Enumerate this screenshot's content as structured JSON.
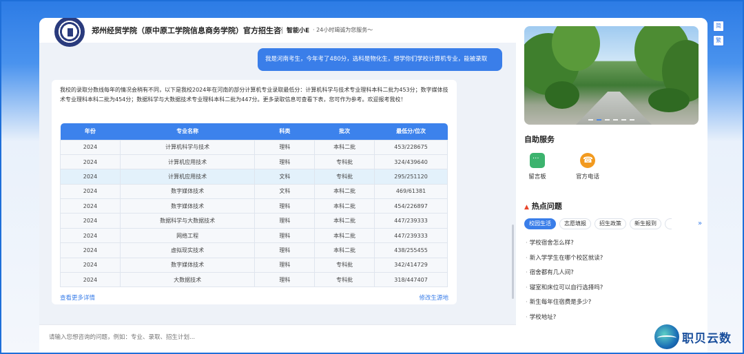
{
  "header": {
    "title": "郑州经贸学院（原中原工学院信息商务学院）官方招生咨询...",
    "agent": "智能小E",
    "tagline": "· 24小时竭诚为您服务～"
  },
  "chat": {
    "user_message": "我是河南考生，今年考了480分，选科是物化生，想学你们学校计算机专业，能被录取",
    "bot_intro": "我校的录取分数线每年的情况会稍有不同，以下是我校2024年在河南的部分计算机专业录取最低分：计算机科学与技术专业理科本科二批为453分；数字媒体技术专业理科本科二批为454分；数据科学与大数据技术专业理科本科二批为447分。更多录取信息可查看下表，您可作为参考。欢迎报考我校！",
    "table": {
      "headers": [
        "年份",
        "专业名称",
        "科类",
        "批次",
        "最低分/位次"
      ],
      "rows": [
        [
          "2024",
          "计算机科学与技术",
          "理科",
          "本科二批",
          "453/228675"
        ],
        [
          "2024",
          "计算机应用技术",
          "理科",
          "专科批",
          "324/439640"
        ],
        [
          "2024",
          "计算机应用技术",
          "文科",
          "专科批",
          "295/251120"
        ],
        [
          "2024",
          "数字媒体技术",
          "文科",
          "本科二批",
          "469/61381"
        ],
        [
          "2024",
          "数字媒体技术",
          "理科",
          "本科二批",
          "454/226897"
        ],
        [
          "2024",
          "数据科学与大数据技术",
          "理科",
          "本科二批",
          "447/239333"
        ],
        [
          "2024",
          "网络工程",
          "理科",
          "本科二批",
          "447/239333"
        ],
        [
          "2024",
          "虚拟现实技术",
          "理科",
          "本科二批",
          "438/255455"
        ],
        [
          "2024",
          "数字媒体技术",
          "理科",
          "专科批",
          "342/414729"
        ],
        [
          "2024",
          "大数据技术",
          "理科",
          "专科批",
          "318/447407"
        ]
      ]
    },
    "more_link": "查看更多详情",
    "edit_link": "修改生源地"
  },
  "input": {
    "placeholder": "请输入您想咨询的问题，例如：专业、录取、招生计划..."
  },
  "sidebar": {
    "self_service_title": "自助服务",
    "services": [
      {
        "label": "留言板",
        "icon": "message-board-icon"
      },
      {
        "label": "官方电话",
        "icon": "phone-icon"
      }
    ],
    "hot_title": "热点问题",
    "tabs": [
      "校园生活",
      "志愿填报",
      "招生政策",
      "新生报到"
    ],
    "faqs": [
      "学校宿舍怎么样?",
      "新入学学生在哪个校区就读?",
      "宿舍都有几人间?",
      "寝室和床位可以自行选择吗?",
      "新生每年住宿费是多少?",
      "学校地址?"
    ]
  },
  "lang": {
    "simplified": "简",
    "traditional": "繁"
  },
  "brand": {
    "name": "职贝云数"
  },
  "colors": {
    "accent": "#3a7ee9",
    "background_top": "#2c7be5"
  }
}
